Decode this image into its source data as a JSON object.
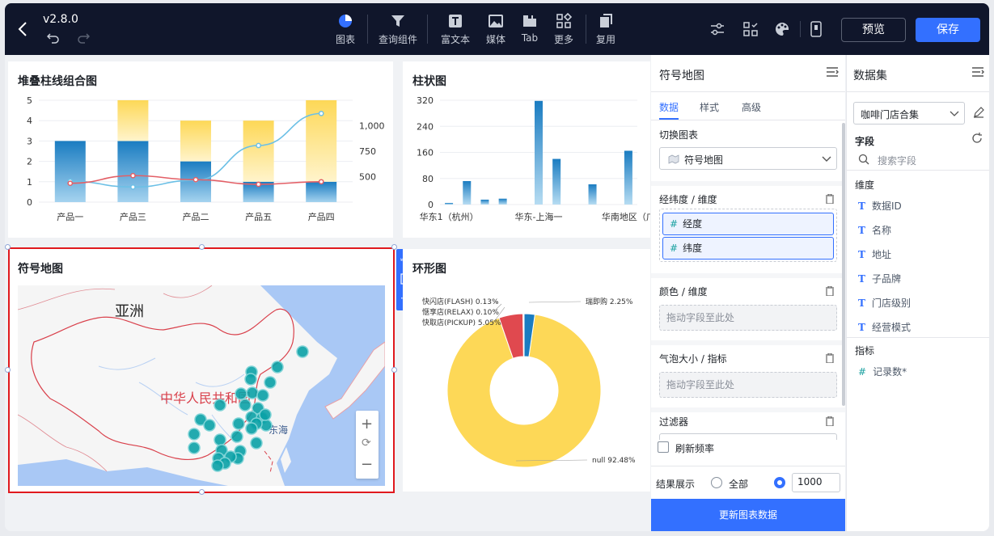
{
  "app": {
    "version": "v2.8.0"
  },
  "toolbar": {
    "items": [
      {
        "label": "图表",
        "icon": "pie-chart-icon"
      },
      {
        "label": "查询组件",
        "icon": "filter-icon"
      },
      {
        "label": "富文本",
        "icon": "text-icon"
      },
      {
        "label": "媒体",
        "icon": "image-icon"
      },
      {
        "label": "Tab",
        "icon": "tab-icon"
      },
      {
        "label": "更多",
        "icon": "more-grid-icon"
      },
      {
        "label": "复用",
        "icon": "copy-icon"
      }
    ],
    "preview_label": "预览",
    "save_label": "保存"
  },
  "charts": {
    "stacked": {
      "title": "堆叠柱线组合图"
    },
    "bar": {
      "title": "柱状图"
    },
    "map": {
      "title": "符号地图",
      "labels": {
        "asia": "亚洲",
        "china": "中华人民共和国",
        "sea": "东海"
      }
    },
    "donut": {
      "title": "环形图"
    }
  },
  "chart_data": [
    {
      "type": "bar",
      "title": "堆叠柱线组合图",
      "categories": [
        "产品一",
        "产品三",
        "产品二",
        "产品五",
        "产品四"
      ],
      "series": [
        {
          "values": [
            3,
            3,
            2,
            1,
            1
          ]
        },
        {
          "values": [
            0,
            2,
            2,
            3,
            4
          ]
        }
      ],
      "lines": [
        {
          "values": [
            455,
            398,
            465,
            806,
            1120
          ]
        },
        {
          "values": [
            435,
            510,
            470,
            425,
            450
          ]
        }
      ],
      "ylim": [
        0,
        5
      ],
      "y2_ticks": [
        500,
        750,
        "1,000"
      ]
    },
    {
      "type": "bar",
      "title": "柱状图",
      "categories": [
        "华东1（杭州）",
        "",
        "",
        "",
        "",
        "华东-上海一",
        "",
        "",
        "",
        "",
        "华南地区（广"
      ],
      "values": [
        5,
        72,
        15,
        18,
        0,
        318,
        140,
        0,
        62,
        0,
        165
      ],
      "ylim": [
        0,
        320
      ],
      "y_ticks": [
        0,
        80,
        160,
        240,
        320
      ]
    },
    {
      "type": "pie",
      "title": "环形图",
      "slices": [
        {
          "name": "快闪店(FLASH)",
          "value": 0.13,
          "label": "快闪店(FLASH) 0.13%"
        },
        {
          "name": "惬享店(RELAX)",
          "value": 0.1,
          "label": "惬享店(RELAX) 0.10%"
        },
        {
          "name": "快取店(PICKUP)",
          "value": 5.05,
          "label": "快取店(PICKUP) 5.05%"
        },
        {
          "name": "瑞即购",
          "value": 2.25,
          "label": "瑞即购 2.25%"
        },
        {
          "name": "null",
          "value": 92.48,
          "label": "null 92.48%"
        }
      ]
    }
  ],
  "config_panel": {
    "title": "符号地图",
    "tabs": [
      "数据",
      "样式",
      "高级"
    ],
    "switch_label": "切换图表",
    "switch_value": "符号地图",
    "lnglat_label": "经纬度 / 维度",
    "lnglat_items": [
      "经度",
      "纬度"
    ],
    "color_label": "颜色 / 维度",
    "color_placeholder": "拖动字段至此处",
    "size_label": "气泡大小 / 指标",
    "size_placeholder": "拖动字段至此处",
    "filter_label": "过滤器",
    "refresh_label": "刷新频率",
    "result_label": "结果展示",
    "result_all": "全部",
    "result_value": "1000",
    "update_button": "更新图表数据"
  },
  "dataset_panel": {
    "title": "数据集",
    "selected": "咖啡门店合集",
    "fields_label": "字段",
    "search_placeholder": "搜索字段",
    "dimension_label": "维度",
    "dimensions": [
      "数据ID",
      "名称",
      "地址",
      "子品牌",
      "门店级别",
      "经营模式"
    ],
    "metric_label": "指标",
    "metrics": [
      "记录数*"
    ]
  },
  "colors": {
    "accent": "#3370ff",
    "topbar": "#10162b",
    "bar_blue": "#1a7cc1",
    "bar_yellow": "#fdd857",
    "map_dot": "#0aa1a6"
  }
}
